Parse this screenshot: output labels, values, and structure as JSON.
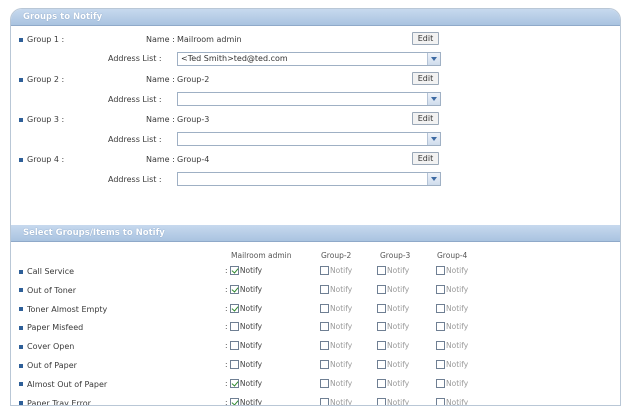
{
  "groups_section": {
    "title": "Groups to Notify",
    "name_label": "Name :",
    "address_label": "Address List :",
    "edit_label": "Edit",
    "groups": [
      {
        "label": "Group 1 :",
        "name": "Mailroom admin",
        "address": "<Ted Smith>ted@ted.com"
      },
      {
        "label": "Group 2 :",
        "name": "Group-2",
        "address": ""
      },
      {
        "label": "Group 3 :",
        "name": "Group-3",
        "address": ""
      },
      {
        "label": "Group 4 :",
        "name": "Group-4",
        "address": ""
      }
    ]
  },
  "items_section": {
    "title": "Select Groups/Items to Notify",
    "columns": [
      "Mailroom admin",
      "Group-2",
      "Group-3",
      "Group-4"
    ],
    "notify_label": "Notify",
    "items": [
      {
        "label": "Call Service",
        "checks": [
          true,
          false,
          false,
          false
        ]
      },
      {
        "label": "Out of Toner",
        "checks": [
          true,
          false,
          false,
          false
        ]
      },
      {
        "label": "Toner Almost Empty",
        "checks": [
          true,
          false,
          false,
          false
        ]
      },
      {
        "label": "Paper Misfeed",
        "checks": [
          false,
          false,
          false,
          false
        ]
      },
      {
        "label": "Cover Open",
        "checks": [
          false,
          false,
          false,
          false
        ]
      },
      {
        "label": "Out of Paper",
        "checks": [
          false,
          false,
          false,
          false
        ]
      },
      {
        "label": "Almost Out of Paper",
        "checks": [
          true,
          false,
          false,
          false
        ]
      },
      {
        "label": "Paper Tray Error",
        "checks": [
          true,
          false,
          false,
          false
        ]
      }
    ]
  }
}
